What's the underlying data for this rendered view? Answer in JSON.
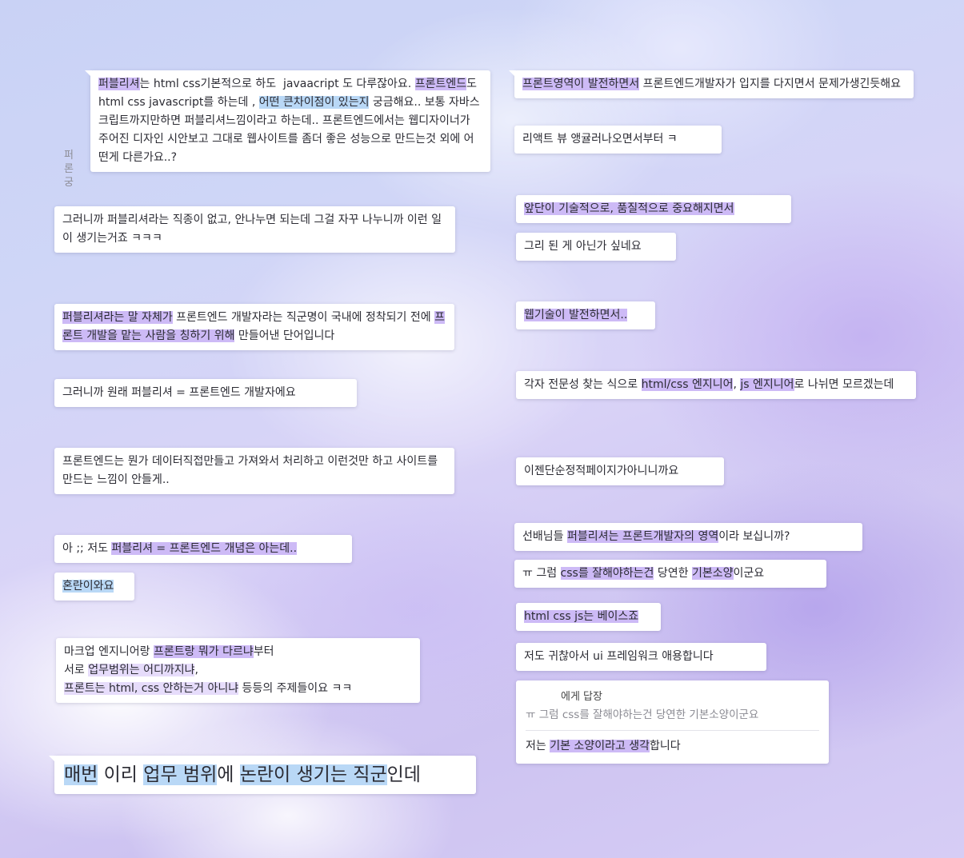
{
  "left": {
    "sender_name": "퍼론궁",
    "m1": {
      "t1": "퍼블리셔",
      "t2": "는 html css기본적으로 하도  javaacript 도 다루잖아요. ",
      "t3": "프론트엔드",
      "t4": "도 html css javascript를 하는데 , ",
      "t5": "어떤 큰차이점이 있는지",
      "t6": " 궁금해요.. 보통 자바스크립트까지만하면 퍼블리셔느낌이라고 하는데.. 프론트엔드에서는 웹디자이너가 주어진 디자인 시안보고 그대로 웹사이트를 좀더 좋은 성능으로 만드는것 외에 어떤게 다른가요..?"
    },
    "m2": "그러니까 퍼블리셔라는 직종이 없고, 안나누면 되는데 그걸 자꾸 나누니까 이런 일이 생기는거죠 ㅋㅋㅋ",
    "m3": {
      "t1": "퍼블리셔라는 말 자체가",
      "t2": " 프론트엔드 개발자라는 직군명이 국내에 정착되기 전에 ",
      "t3": "프론트 개발을 맡는 사람을 칭하기 위해",
      "t4": " 만들어낸 단어입니다"
    },
    "m4": "그러니까 원래 퍼블리셔 = 프론트엔드 개발자에요",
    "m5": "프론트엔드는 뭔가 데이터직접만들고 가져와서 처리하고 이런것만 하고 사이트를 만드는 느낌이 안들게..",
    "m6": {
      "t1": "아 ;; 저도 ",
      "t2": "퍼블리셔 = 프론트엔드 개념은 아는데.."
    },
    "m7": "혼란이와요",
    "m8": {
      "t1": "마크업 엔지니어랑 ",
      "t2": "프론트랑 뭐가 다르냐",
      "t3": "부터",
      "t4": "서로 ",
      "t5": "업무범위는 어디까지냐",
      "t6": ",",
      "t7": "프론트는 html, css 안하는거 아니냐",
      "t8": " 등등의 주제들이요 ㅋㅋ"
    },
    "m9": {
      "t1": "매번",
      "t2": " 이리 ",
      "t3": "업무 범위",
      "t4": "에 ",
      "t5": "논란이 생기는 직군",
      "t6": "인데"
    }
  },
  "right": {
    "r1": {
      "t1": "프론트영역이 발전하면서",
      "t2": " 프론트엔드개발자가 입지를 다지면서 문제가생긴듯해요"
    },
    "r2": "리액트 뷰 앵귤러나오면서부터 ㅋ",
    "r3": "앞단이 기술적으로, 품질적으로 중요해지면서",
    "r4": "그리 된 게 아닌가 싶네요",
    "r5": "웹기술이 발전하면서..",
    "r6": {
      "t1": "각자 전문성 찾는 식으로 ",
      "t2": "html/css 엔지니어",
      "t3": ", ",
      "t4": "js 엔지니어",
      "t5": "로 나뉘면 모르겠는데"
    },
    "r7": "이젠단순정적페이지가아니니까요",
    "r8": {
      "t1": "선배님들 ",
      "t2": "퍼블리셔는 프론트개발자의 영역",
      "t3": "이라 보십니까?"
    },
    "r9": {
      "t1": "ㅠ 그럼 ",
      "t2": "css를 잘해야하는건",
      "t3": " 당연한 ",
      "t4": "기본소양",
      "t5": "이군요"
    },
    "r10": "html css js는 베이스죠",
    "r11": "저도 귀찮아서 ui 프레임워크 애용합니다",
    "reply": {
      "name": "에게 답장",
      "quote": "ㅠ 그럼 css를 잘해야하는건 당연한 기본소양이군요",
      "t1": "저는 ",
      "t2": "기본 소양이라고 생각",
      "t3": "합니다"
    }
  }
}
